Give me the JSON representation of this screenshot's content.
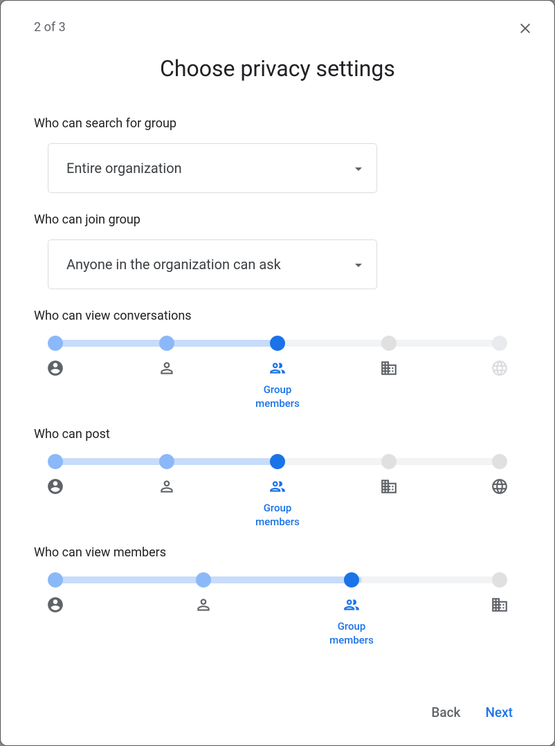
{
  "step": "2 of 3",
  "title": "Choose privacy settings",
  "sections": {
    "search": {
      "title": "Who can search for group",
      "value": "Entire organization"
    },
    "join": {
      "title": "Who can join group",
      "value": "Anyone in the organization can ask"
    }
  },
  "sliders": {
    "view_conversations": {
      "title": "Who can view conversations",
      "selected_label": "Group members",
      "options": [
        {
          "icon": "owner",
          "state": "included"
        },
        {
          "icon": "manager",
          "state": "included"
        },
        {
          "icon": "group",
          "state": "selected",
          "label": "Group members"
        },
        {
          "icon": "org",
          "state": "available"
        },
        {
          "icon": "globe",
          "state": "disabled"
        }
      ]
    },
    "post": {
      "title": "Who can post",
      "selected_label": "Group members",
      "options": [
        {
          "icon": "owner",
          "state": "included"
        },
        {
          "icon": "manager",
          "state": "included"
        },
        {
          "icon": "group",
          "state": "selected",
          "label": "Group members"
        },
        {
          "icon": "org",
          "state": "available"
        },
        {
          "icon": "globe",
          "state": "available"
        }
      ]
    },
    "view_members": {
      "title": "Who can view members",
      "selected_label": "Group members",
      "options": [
        {
          "icon": "owner",
          "state": "included"
        },
        {
          "icon": "manager",
          "state": "included"
        },
        {
          "icon": "group",
          "state": "selected",
          "label": "Group members"
        },
        {
          "icon": "org",
          "state": "available"
        }
      ]
    }
  },
  "footer": {
    "back": "Back",
    "next": "Next"
  }
}
